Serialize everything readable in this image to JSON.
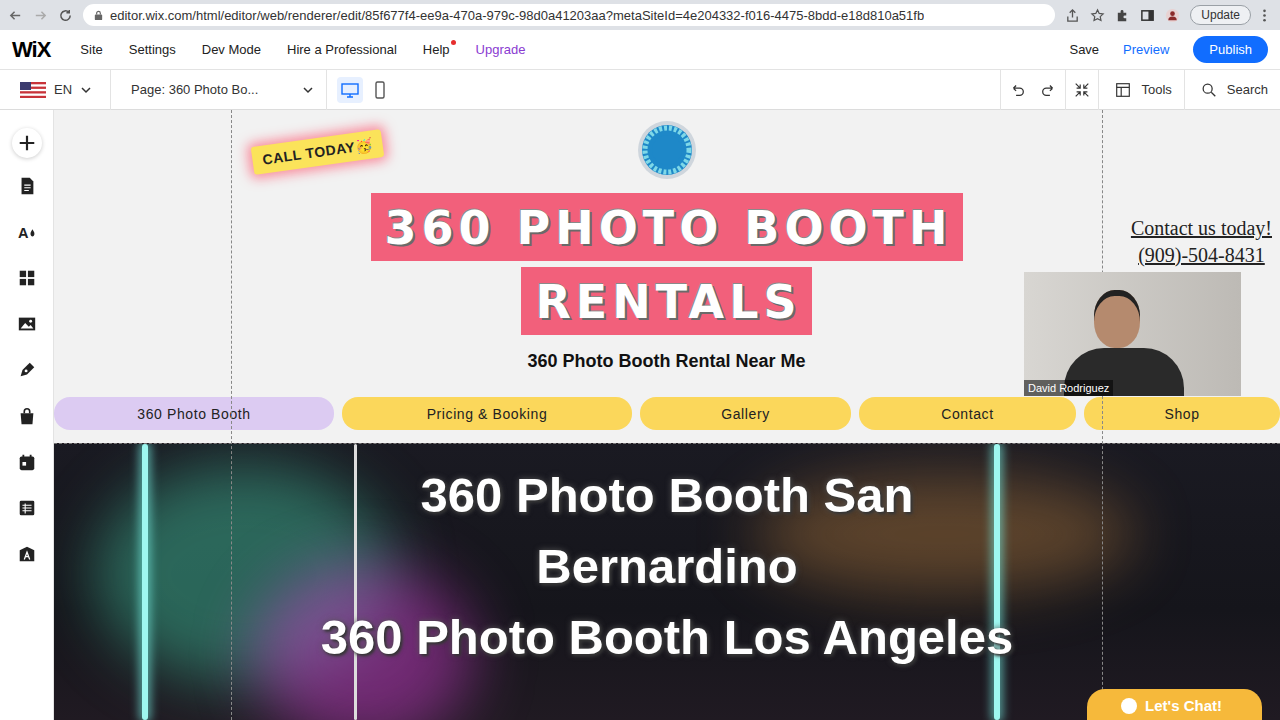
{
  "browser": {
    "url": "editor.wix.com/html/editor/web/renderer/edit/85f677f4-ee9a-470a-979c-98d0a41203aa?metaSiteId=4e204332-f016-4475-8bdd-e18d810a51fb",
    "update_button": "Update"
  },
  "editor": {
    "logo": "WiX",
    "menu": [
      {
        "label": "Site",
        "kind": "plain"
      },
      {
        "label": "Settings",
        "kind": "plain"
      },
      {
        "label": "Dev Mode",
        "kind": "plain"
      },
      {
        "label": "Hire a Professional",
        "kind": "plain"
      },
      {
        "label": "Help",
        "kind": "notified"
      },
      {
        "label": "Upgrade",
        "kind": "upgrade"
      }
    ],
    "save": "Save",
    "preview": "Preview",
    "publish": "Publish"
  },
  "toolbar": {
    "language": "EN",
    "page": "Page: 360 Photo Bo...",
    "views": [
      {
        "kind": "desktop",
        "selected": true
      },
      {
        "kind": "mobile",
        "selected": false
      }
    ],
    "tools": "Tools",
    "search": "Search"
  },
  "site": {
    "badge": "CALL TODAY🥳",
    "title_lines": [
      "360 PHOTO BOOTH",
      "RENTALS"
    ],
    "subtitle": "360 Photo Booth Rental Near Me",
    "contact": {
      "heading": "Contact us today!",
      "phone": "(909)-504-8431"
    },
    "nav": [
      {
        "label": "360 Photo Booth",
        "selected": true
      },
      {
        "label": "Pricing & Booking",
        "selected": false
      },
      {
        "label": "Gallery",
        "selected": false
      },
      {
        "label": "Contact",
        "selected": false
      },
      {
        "label": "Shop",
        "selected": false
      }
    ],
    "hero_lines": [
      "360 Photo Booth San",
      "Bernardino",
      "360 Photo Booth Los Angeles"
    ],
    "chat_button": "Let's Chat!"
  },
  "webcam": {
    "name": "David Rodriguez"
  }
}
